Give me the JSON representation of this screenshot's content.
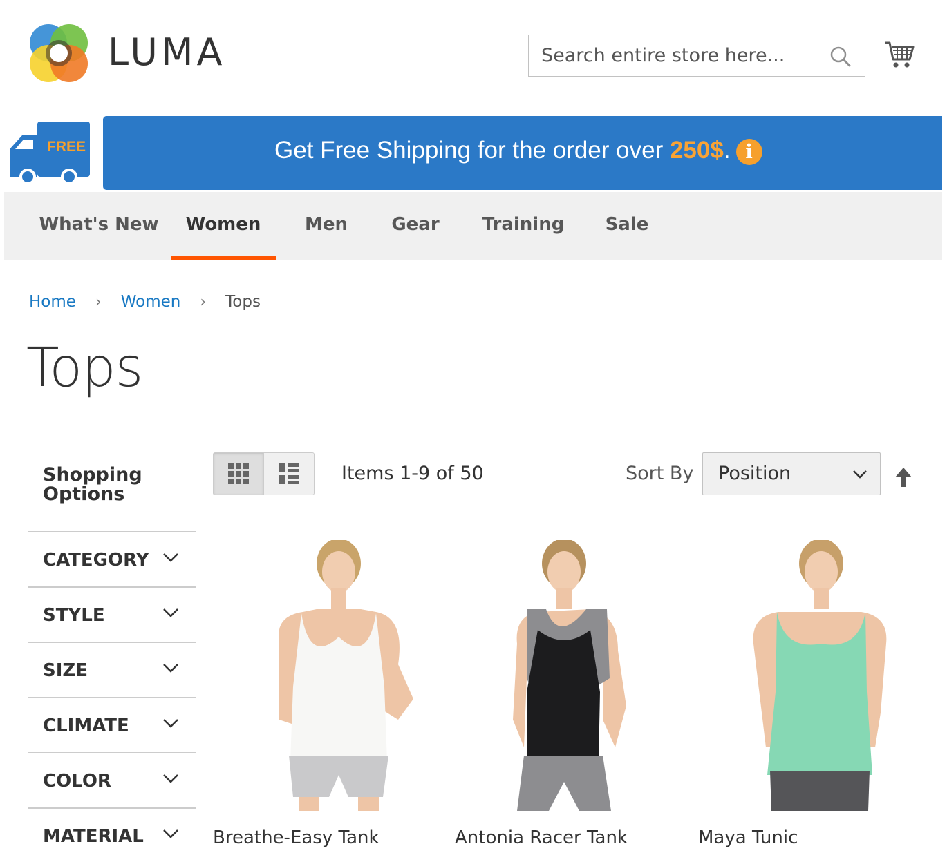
{
  "header": {
    "logo_text": "LUMA",
    "search_placeholder": "Search entire store here..."
  },
  "promo": {
    "truck_label": "FREE",
    "text": "Get Free Shipping for the order over ",
    "amount": "250$",
    "suffix": "."
  },
  "nav": {
    "items": [
      {
        "label": "What's New"
      },
      {
        "label": "Women",
        "active": true
      },
      {
        "label": "Men"
      },
      {
        "label": "Gear"
      },
      {
        "label": "Training"
      },
      {
        "label": "Sale"
      }
    ]
  },
  "breadcrumb": [
    "Home",
    "Women",
    "Tops"
  ],
  "page_title": "Tops",
  "sidebar": {
    "title": "Shopping Options",
    "filters": [
      "CATEGORY",
      "STYLE",
      "SIZE",
      "CLIMATE",
      "COLOR",
      "MATERIAL"
    ]
  },
  "toolbar": {
    "amount": "Items 1-9 of 50",
    "sort_label": "Sort By",
    "sort_value": "Position"
  },
  "products": [
    {
      "name": "Breathe-Easy Tank",
      "top_color": "#f7f7f5",
      "bottom_color": "#c9c9cb"
    },
    {
      "name": "Antonia Racer Tank",
      "top_color": "#1c1c1e",
      "bottom_color": "#8d8d90"
    },
    {
      "name": "Maya Tunic",
      "top_color": "#86d8b4",
      "bottom_color": "#555558"
    }
  ],
  "colors": {
    "accent_blue": "#2b79c7",
    "accent_orange": "#ff5501",
    "link": "#1979c3"
  }
}
